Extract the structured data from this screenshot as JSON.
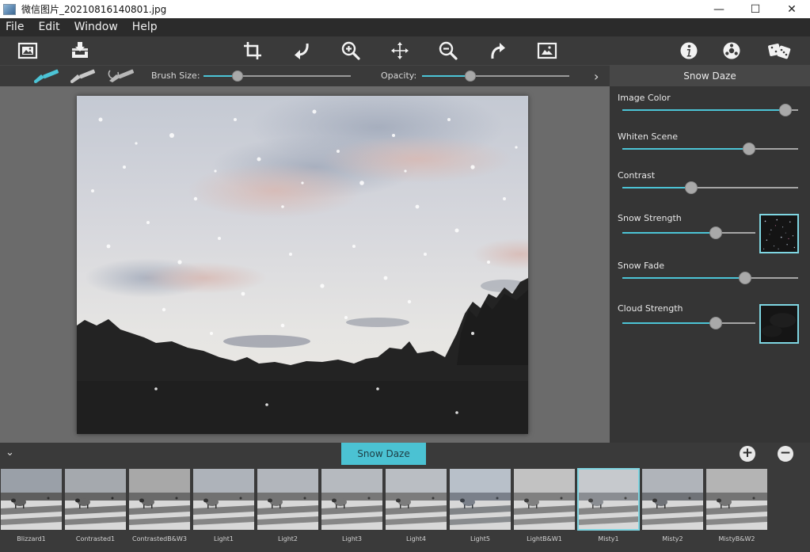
{
  "window": {
    "title": "微信图片_20210816140801.jpg",
    "minimize": "—",
    "maximize": "☐",
    "close": "✕"
  },
  "menu": [
    "File",
    "Edit",
    "Window",
    "Help"
  ],
  "toolbar": {
    "icons": [
      "open-image-icon",
      "save-icon",
      "crop-icon",
      "rotate-left-icon",
      "zoom-in-icon",
      "pan-icon",
      "zoom-out-icon",
      "rotate-right-icon",
      "fit-image-icon",
      "info-icon",
      "settings-icon",
      "random-icon"
    ]
  },
  "brushbar": {
    "brush_size_label": "Brush Size:",
    "brush_size_value": 0.23,
    "opacity_label": "Opacity:",
    "opacity_value": 0.33,
    "next_arrow": "›"
  },
  "panel": {
    "title": "Snow Daze",
    "controls": [
      {
        "label": "Image Color",
        "value": 0.93,
        "has_thumb": false
      },
      {
        "label": "Whiten Scene",
        "value": 0.72,
        "has_thumb": false
      },
      {
        "label": "Contrast",
        "value": 0.39,
        "has_thumb": false
      },
      {
        "label": "Snow Strength",
        "value": 0.7,
        "has_thumb": true,
        "thumb": "snow-texture"
      },
      {
        "label": "Snow Fade",
        "value": 0.7,
        "has_thumb": false
      },
      {
        "label": "Cloud Strength",
        "value": 0.7,
        "has_thumb": true,
        "thumb": "cloud-texture"
      }
    ]
  },
  "presets": {
    "collapse_icon": "⌄",
    "active_tab": "Snow Daze",
    "add_label": "+",
    "remove_label": "−",
    "items": [
      {
        "label": "Blizzard1",
        "selected": false
      },
      {
        "label": "Contrasted1",
        "selected": false
      },
      {
        "label": "ContrastedB&W3",
        "selected": false
      },
      {
        "label": "Light1",
        "selected": false
      },
      {
        "label": "Light2",
        "selected": false
      },
      {
        "label": "Light3",
        "selected": false
      },
      {
        "label": "Light4",
        "selected": false
      },
      {
        "label": "Light5",
        "selected": false
      },
      {
        "label": "LightB&W1",
        "selected": false
      },
      {
        "label": "Misty1",
        "selected": true
      },
      {
        "label": "Misty2",
        "selected": false
      },
      {
        "label": "MistyB&W2",
        "selected": false
      }
    ]
  },
  "colors": {
    "accent": "#4cc4d6",
    "panel_bg": "#353535",
    "canvas_bg": "#6b6b6b"
  }
}
